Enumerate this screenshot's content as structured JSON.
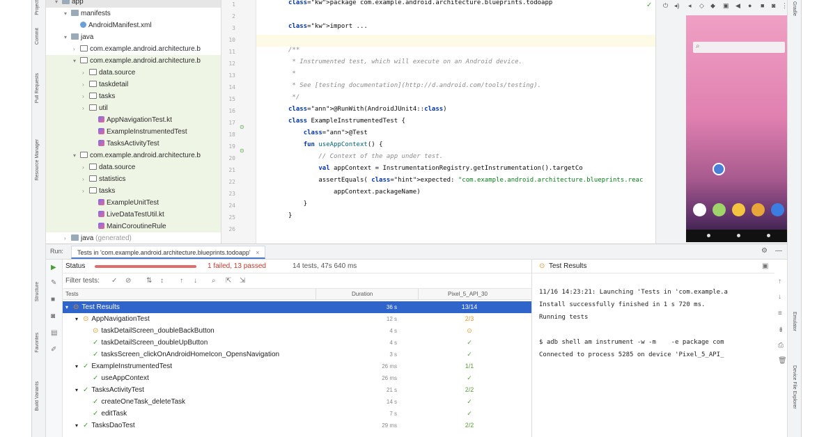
{
  "left_strip": [
    "Project",
    "Commit",
    "Pull Requests",
    "Resource Manager",
    "Structure",
    "Favorites",
    "Build Variants"
  ],
  "right_strip": [
    "Gradle",
    "Emulator",
    "Device File Explorer"
  ],
  "tree": [
    {
      "indent": 1,
      "icon": "folder",
      "label": "app",
      "style": "top",
      "arrow": "▾"
    },
    {
      "indent": 2,
      "icon": "folder",
      "label": "manifests",
      "arrow": "▾"
    },
    {
      "indent": 3,
      "icon": "file",
      "label": "AndroidManifest.xml",
      "arrow": ""
    },
    {
      "indent": 2,
      "icon": "folder",
      "label": "java",
      "arrow": "▾"
    },
    {
      "indent": 3,
      "icon": "pkg",
      "label": "com.example.android.architecture.b",
      "arrow": "›"
    },
    {
      "indent": 3,
      "icon": "pkg",
      "label": "com.example.android.architecture.b",
      "style": "green",
      "arrow": "▾"
    },
    {
      "indent": 4,
      "icon": "pkg",
      "label": "data.source",
      "style": "green",
      "arrow": "›"
    },
    {
      "indent": 4,
      "icon": "pkg",
      "label": "taskdetail",
      "style": "green",
      "arrow": "›"
    },
    {
      "indent": 4,
      "icon": "pkg",
      "label": "tasks",
      "style": "green",
      "arrow": "›"
    },
    {
      "indent": 4,
      "icon": "pkg",
      "label": "util",
      "style": "green",
      "arrow": "›"
    },
    {
      "indent": 5,
      "icon": "kt",
      "label": "AppNavigationTest.kt",
      "style": "green",
      "arrow": ""
    },
    {
      "indent": 5,
      "icon": "kt",
      "label": "ExampleInstrumentedTest",
      "style": "green",
      "arrow": ""
    },
    {
      "indent": 5,
      "icon": "kt",
      "label": "TasksActivityTest",
      "style": "green",
      "arrow": ""
    },
    {
      "indent": 3,
      "icon": "pkg",
      "label": "com.example.android.architecture.b",
      "style": "green",
      "arrow": "▾"
    },
    {
      "indent": 4,
      "icon": "pkg",
      "label": "data.source",
      "style": "green",
      "arrow": "›"
    },
    {
      "indent": 4,
      "icon": "pkg",
      "label": "statistics",
      "style": "green",
      "arrow": "›"
    },
    {
      "indent": 4,
      "icon": "pkg",
      "label": "tasks",
      "style": "green",
      "arrow": "›"
    },
    {
      "indent": 5,
      "icon": "kt",
      "label": "ExampleUnitTest",
      "style": "green",
      "arrow": ""
    },
    {
      "indent": 5,
      "icon": "kt",
      "label": "LiveDataTestUtil.kt",
      "style": "green",
      "arrow": ""
    },
    {
      "indent": 5,
      "icon": "kt",
      "label": "MainCoroutineRule",
      "style": "green",
      "arrow": ""
    },
    {
      "indent": 2,
      "icon": "folder",
      "label": "java",
      "suffix": "(generated)",
      "arrow": "›"
    }
  ],
  "editor": {
    "line_numbers": [
      "1",
      "2",
      "3",
      "10",
      "11",
      "12",
      "13",
      "14",
      "15",
      "16",
      "17",
      "18",
      "19",
      "20",
      "21",
      "22",
      "23",
      "24",
      "25",
      "26"
    ],
    "lines": [
      "package com.example.android.architecture.blueprints.todoapp",
      "",
      "import ...",
      "",
      "/**",
      " * Instrumented test, which will execute on an Android device.",
      " *",
      " * See [testing documentation](http://d.android.com/tools/testing).",
      " */",
      "@RunWith(AndroidJUnit4::class)",
      "class ExampleInstrumentedTest {",
      "    @Test",
      "    fun useAppContext() {",
      "        // Context of the app under test.",
      "        val appContext = InstrumentationRegistry.getInstrumentation().targetCo",
      "        assertEquals( expected: \"com.example.android.architecture.blueprints.reac",
      "            appContext.packageName)",
      "    }",
      "}",
      ""
    ]
  },
  "run": {
    "label": "Run:",
    "tab": "Tests in 'com.example.android.architecture.blueprints.todoapp'",
    "tab_close": "×",
    "status_label": "Status",
    "progress_fraction": 1.0,
    "failed_text": "1 failed, 13 passed",
    "summary_text": "14 tests, 47s 640 ms",
    "filter_label": "Filter tests:",
    "columns": {
      "tests": "Tests",
      "duration": "Duration",
      "device": "Pixel_5_API_30"
    },
    "rows": [
      {
        "indent": 0,
        "arrow": "▾",
        "status": "warn",
        "name": "Test Results",
        "duration": "36 s",
        "device": "13/14",
        "selected": true
      },
      {
        "indent": 1,
        "arrow": "▾",
        "status": "warn",
        "name": "AppNavigationTest",
        "duration": "12 s",
        "device": "2/3",
        "device_status": "warn"
      },
      {
        "indent": 2,
        "arrow": "",
        "status": "warn",
        "name": "taskDetailScreen_doubleBackButton",
        "duration": "4 s",
        "device": "⊙",
        "device_status": "warn"
      },
      {
        "indent": 2,
        "arrow": "",
        "status": "ok",
        "name": "taskDetailScreen_doubleUpButton",
        "duration": "4 s",
        "device": "✓"
      },
      {
        "indent": 2,
        "arrow": "",
        "status": "ok",
        "name": "tasksScreen_clickOnAndroidHomeIcon_OpensNavigation",
        "duration": "3 s",
        "device": "✓"
      },
      {
        "indent": 1,
        "arrow": "▾",
        "status": "ok",
        "name": "ExampleInstrumentedTest",
        "duration": "26 ms",
        "device": "1/1"
      },
      {
        "indent": 2,
        "arrow": "",
        "status": "ok",
        "name": "useAppContext",
        "duration": "26 ms",
        "device": "✓"
      },
      {
        "indent": 1,
        "arrow": "▾",
        "status": "ok",
        "name": "TasksActivityTest",
        "duration": "21 s",
        "device": "2/2"
      },
      {
        "indent": 2,
        "arrow": "",
        "status": "ok",
        "name": "createOneTask_deleteTask",
        "duration": "14 s",
        "device": "✓"
      },
      {
        "indent": 2,
        "arrow": "",
        "status": "ok",
        "name": "editTask",
        "duration": "7 s",
        "device": "✓"
      },
      {
        "indent": 1,
        "arrow": "▾",
        "status": "ok",
        "name": "TasksDaoTest",
        "duration": "29 ms",
        "device": "2/2"
      }
    ]
  },
  "console": {
    "title": "Test Results",
    "lines": [
      "11/16 14:23:21: Launching 'Tests in 'com.example.a",
      "Install successfully finished in 1 s 720 ms.",
      "Running tests",
      "",
      "$ adb shell am instrument -w -m    -e package com",
      "Connected to process 5285 on device 'Pixel_5_API_"
    ]
  },
  "colors": {
    "accent": "#2f65ca",
    "pass": "#4a9e3a",
    "fail": "#e06c6c",
    "warn": "#e0962e"
  }
}
